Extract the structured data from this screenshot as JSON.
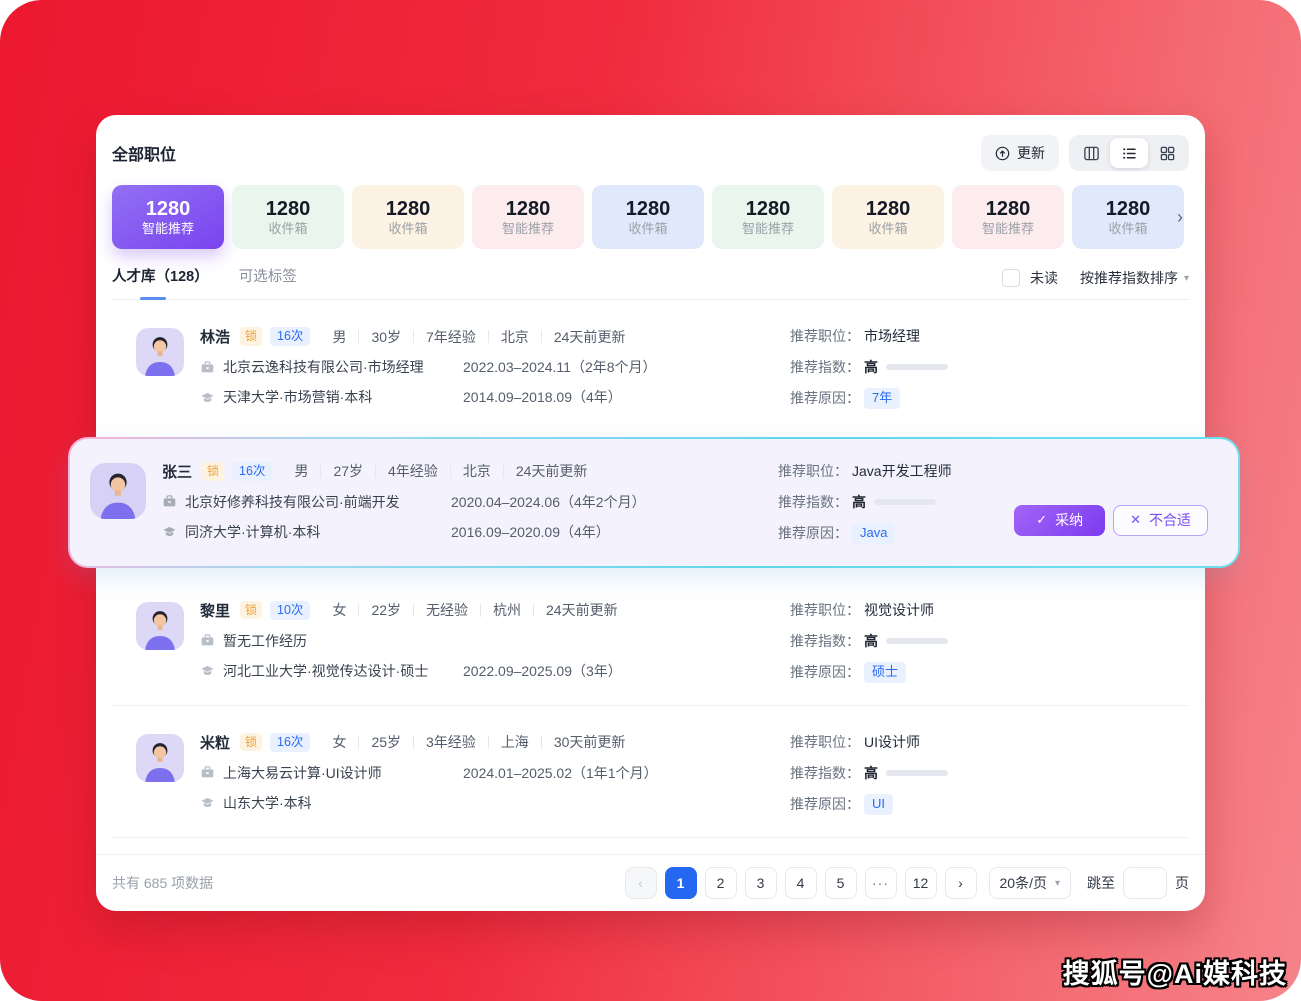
{
  "window": {
    "title": "全部职位",
    "watermark": "搜狐号@Ai媒科技"
  },
  "toolbar": {
    "update_label": "更新",
    "icons": {
      "update": "arrow-up-circle-icon",
      "view1": "columns-view-icon",
      "view2": "list-view-icon",
      "view3": "grid-view-icon"
    }
  },
  "glyphs": {
    "chevron_right": "›",
    "chevron_left": "‹",
    "caret_down": "▾",
    "check": "✓",
    "cross": "✕",
    "ellipsis": "···"
  },
  "job_tabs": [
    {
      "count": "1280",
      "label": "智能推荐",
      "theme": "purple",
      "active": true
    },
    {
      "count": "1280",
      "label": "收件箱",
      "theme": "green",
      "active": false
    },
    {
      "count": "1280",
      "label": "收件箱",
      "theme": "cream",
      "active": false
    },
    {
      "count": "1280",
      "label": "智能推荐",
      "theme": "pink",
      "active": false
    },
    {
      "count": "1280",
      "label": "收件箱",
      "theme": "blue",
      "active": false
    },
    {
      "count": "1280",
      "label": "智能推荐",
      "theme": "green",
      "active": false
    },
    {
      "count": "1280",
      "label": "收件箱",
      "theme": "cream",
      "active": false
    },
    {
      "count": "1280",
      "label": "智能推荐",
      "theme": "pink",
      "active": false
    },
    {
      "count": "1280",
      "label": "收件箱",
      "theme": "blue",
      "active": false
    }
  ],
  "filter": {
    "talent_tab": "人才库（128）",
    "tags_tab": "可选标签",
    "unread_label": "未读",
    "sort_label": "按推荐指数排序"
  },
  "rec_labels": {
    "job": "推荐职位：",
    "index": "推荐指数：",
    "reason": "推荐原因："
  },
  "candidates": [
    {
      "name": "林浩",
      "lock": "锁",
      "times": "16次",
      "meta": [
        "男",
        "30岁",
        "7年经验",
        "北京",
        "24天前更新"
      ],
      "work": "北京云逸科技有限公司·市场经理",
      "work_period": "2022.03–2024.11（2年8个月）",
      "edu": "天津大学·市场营销·本科",
      "edu_period": "2014.09–2018.09（4年）",
      "rec_job": "市场经理",
      "rec_level": "高",
      "rec_reason": "7年"
    },
    {
      "name": "张三",
      "lock": "锁",
      "times": "16次",
      "meta": [
        "男",
        "27岁",
        "4年经验",
        "北京",
        "24天前更新"
      ],
      "work": "北京好修养科技有限公司·前端开发",
      "work_period": "2020.04–2024.06（4年2个月）",
      "edu": "同济大学·计算机·本科",
      "edu_period": "2016.09–2020.09（4年）",
      "rec_job": "Java开发工程师",
      "rec_level": "高",
      "rec_reason": "Java",
      "actions": {
        "accept": "采纳",
        "reject": "不合适"
      }
    },
    {
      "name": "黎里",
      "lock": "锁",
      "times": "10次",
      "meta": [
        "女",
        "22岁",
        "无经验",
        "杭州",
        "24天前更新"
      ],
      "work": "暂无工作经历",
      "work_period": "",
      "edu": "河北工业大学·视觉传达设计·硕士",
      "edu_period": "2022.09–2025.09（3年）",
      "rec_job": "视觉设计师",
      "rec_level": "高",
      "rec_reason": "硕士"
    },
    {
      "name": "米粒",
      "lock": "锁",
      "times": "16次",
      "meta": [
        "女",
        "25岁",
        "3年经验",
        "上海",
        "30天前更新"
      ],
      "work": "上海大易云计算·UI设计师",
      "work_period": "2024.01–2025.02（1年1个月）",
      "edu": "山东大学·本科",
      "edu_period": "",
      "rec_job": "UI设计师",
      "rec_level": "高",
      "rec_reason": "UI"
    }
  ],
  "pagination": {
    "total": "共有 685 项数据",
    "pages": [
      "1",
      "2",
      "3",
      "4",
      "5",
      "···",
      "12"
    ],
    "active_page": "1",
    "page_size": "20条/页",
    "jump_label": "跳至",
    "unit": "页"
  },
  "colors": {
    "accent_blue": "#2a6bf2",
    "progress_blue": "#2d50e6",
    "page_active_blue": "#2468f2",
    "active_tab_gradient_from": "#9271f5",
    "active_tab_gradient_to": "#7a43ee",
    "bg_red_from": "#ec1830",
    "bg_red_to": "#f6838a",
    "highlight_bg": "#f4f2fd",
    "highlight_border_from": "#ffb1d8",
    "highlight_border_to": "#5fd8ea",
    "lock_orange": "#f0a23c",
    "accept_gradient_from": "#a265f6",
    "accept_gradient_to": "#7c3bf0"
  }
}
